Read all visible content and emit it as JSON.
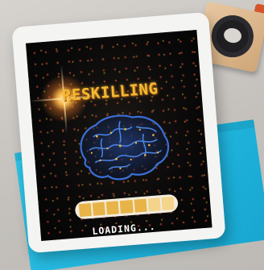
{
  "scene": {
    "background_color": "#c9c6c2",
    "folder_color": "#22b8df",
    "tablet_color": "#f4f4f3"
  },
  "screen": {
    "title": "RESKILLING",
    "status_text": "LOADING...",
    "title_color": "#f3b933",
    "brain_color": "#3a6fd6",
    "brain_highlight": "#f0b640",
    "loading_progress": 0.72
  }
}
